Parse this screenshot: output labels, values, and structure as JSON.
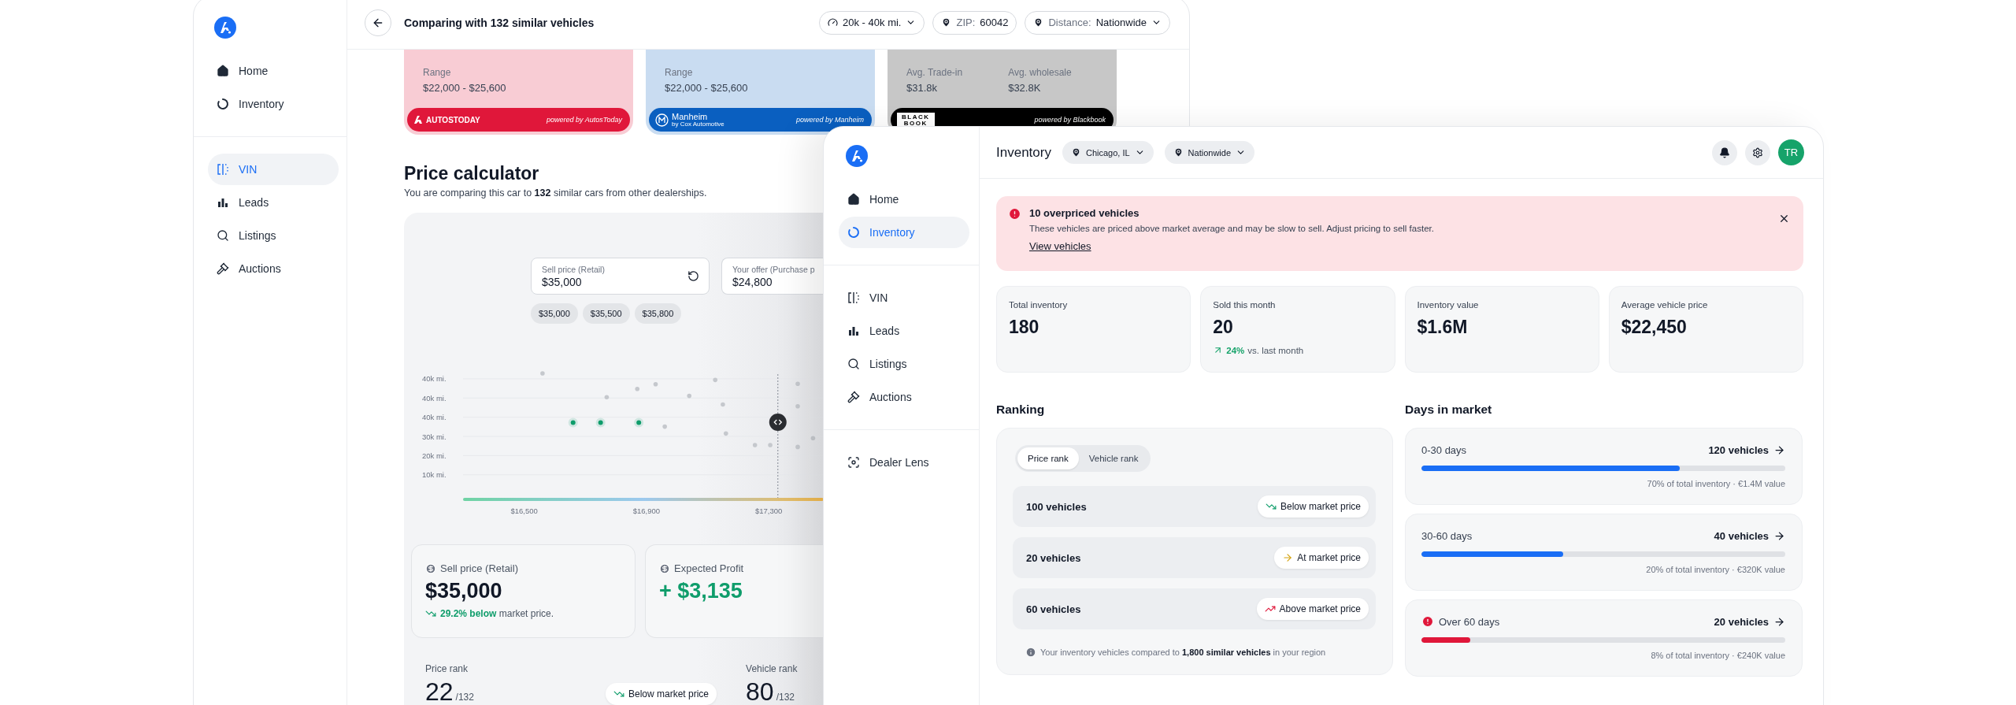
{
  "back_window": {
    "sidebar": {
      "sections": [
        {
          "items": [
            {
              "label": "Home",
              "kind": "home",
              "selected": false
            },
            {
              "label": "Inventory",
              "kind": "inventory",
              "selected": false
            }
          ]
        },
        {
          "items": [
            {
              "label": "VIN",
              "kind": "vin",
              "selected": true
            },
            {
              "label": "Leads",
              "kind": "leads",
              "selected": false
            },
            {
              "label": "Listings",
              "kind": "search",
              "selected": false
            },
            {
              "label": "Auctions",
              "kind": "gavel",
              "selected": false
            }
          ]
        }
      ]
    },
    "header": {
      "title": "Comparing with 132 similar vehicles",
      "filters": [
        {
          "kind": "gauge",
          "value": "20k - 40k mi.",
          "dropdown": true
        },
        {
          "kind": "pin",
          "prefix": "ZIP:",
          "value": "60042",
          "dropdown": false
        },
        {
          "kind": "pin",
          "prefix": "Distance:",
          "value": "Nationwide",
          "dropdown": true
        }
      ]
    },
    "sources": [
      {
        "kind": "range",
        "color": "#e0173a",
        "label": "Range",
        "value": "$22,000 - $25,600",
        "brand": {
          "kind": "autostoday",
          "lines": [
            "AUTOSTODAY"
          ]
        },
        "powered_by": "powered by AutosToday"
      },
      {
        "kind": "range",
        "color": "#0a5fc0",
        "label": "Range",
        "value": "$22,000 - $25,600",
        "brand": {
          "kind": "manheim",
          "lines": [
            "Manheim",
            "by Cox Automotive"
          ]
        },
        "powered_by": "powered by Manheim"
      },
      {
        "kind": "averages",
        "color": "#000000",
        "stats": [
          {
            "label": "Avg. Trade-in",
            "value": "$31.8k"
          },
          {
            "label": "Avg. wholesale",
            "value": "$32.8K"
          }
        ],
        "brand": {
          "kind": "blackbook",
          "lines": [
            "BLACK",
            "BOOK"
          ]
        },
        "powered_by": "powered by Blackbook"
      }
    ],
    "price_calculator": {
      "title": "Price calculator",
      "subtitle": "You are comparing this car to **132** similar cars from other dealerships.",
      "fields": [
        {
          "label": "Sell price (Retail)",
          "value": "$35,000",
          "reset": true
        },
        {
          "label": "Your offer (Purchase p",
          "value": "$24,800"
        }
      ],
      "suggestions": [
        "$35,000",
        "$35,500",
        "$35,800"
      ],
      "chart": {
        "y_labels": [
          "40k mi.",
          "40k mi.",
          "40k mi.",
          "30k mi.",
          "20k mi.",
          "10k mi."
        ],
        "x_labels": [
          "$16,500",
          "$16,900",
          "$17,300"
        ]
      },
      "metrics": [
        {
          "label": "Sell price (Retail)",
          "value": "$35,000",
          "positive": false,
          "note": "**29.2% below** market price."
        },
        {
          "label": "Expected Profit",
          "value": "+ $3,135",
          "positive": true
        }
      ],
      "ranks": [
        {
          "label": "Price rank",
          "value": "22",
          "total": "/132"
        },
        {
          "label": "Vehicle rank",
          "value": "80",
          "total": "/132"
        }
      ],
      "rank_badge": {
        "kind": "below",
        "label": "Below market price"
      }
    }
  },
  "front_window": {
    "sidebar": {
      "sections": [
        {
          "items": [
            {
              "label": "Home",
              "kind": "home",
              "selected": false
            },
            {
              "label": "Inventory",
              "kind": "inventory",
              "selected": true
            }
          ]
        },
        {
          "items": [
            {
              "label": "VIN",
              "kind": "vin",
              "selected": false
            },
            {
              "label": "Leads",
              "kind": "leads",
              "selected": false
            },
            {
              "label": "Listings",
              "kind": "search",
              "selected": false
            },
            {
              "label": "Auctions",
              "kind": "gavel",
              "selected": false
            }
          ]
        },
        {
          "items": [
            {
              "label": "Dealer Lens",
              "kind": "lens",
              "selected": false
            }
          ]
        }
      ]
    },
    "header": {
      "title": "Inventory",
      "locations": [
        "Chicago, IL",
        "Nationwide"
      ],
      "avatar": "TR"
    },
    "alert": {
      "title": "10 overpriced vehicles",
      "message": "These vehicles are priced above market average and may be slow to sell. Adjust pricing to sell faster.",
      "link": "View vehicles"
    },
    "stats": [
      {
        "label": "Total inventory",
        "value": "180"
      },
      {
        "label": "Sold this month",
        "value": "20",
        "change": "24%",
        "change_note": "vs. last month"
      },
      {
        "label": "Inventory value",
        "value": "$1.6M"
      },
      {
        "label": "Average vehicle price",
        "value": "$22,450"
      }
    ],
    "ranking": {
      "title": "Ranking",
      "tabs": [
        {
          "label": "Price rank",
          "selected": true
        },
        {
          "label": "Vehicle rank",
          "selected": false
        }
      ],
      "rows": [
        {
          "count": "100 vehicles",
          "kind": "below",
          "badge": "Below market price"
        },
        {
          "count": "20 vehicles",
          "kind": "at",
          "badge": "At market price"
        },
        {
          "count": "60 vehicles",
          "kind": "above",
          "badge": "Above market price"
        }
      ],
      "note": "Your inventory vehicles compared to **1,800 similar vehicles** in your region"
    },
    "days_in_market": {
      "title": "Days in market",
      "buckets": [
        {
          "label": "0-30 days",
          "count": "120 vehicles",
          "level": 0.71,
          "color": "#1a6ef5",
          "warning": false,
          "detail": "70% of total inventory · €1.4M value"
        },
        {
          "label": "30-60 days",
          "count": "40 vehicles",
          "level": 0.39,
          "color": "#1a6ef5",
          "warning": false,
          "detail": "20% of total inventory · €320K value"
        },
        {
          "label": "Over 60 days",
          "count": "20 vehicles",
          "level": 0.135,
          "color": "#e0173a",
          "warning": true,
          "detail": "8% of total inventory · €240K value"
        }
      ]
    }
  }
}
